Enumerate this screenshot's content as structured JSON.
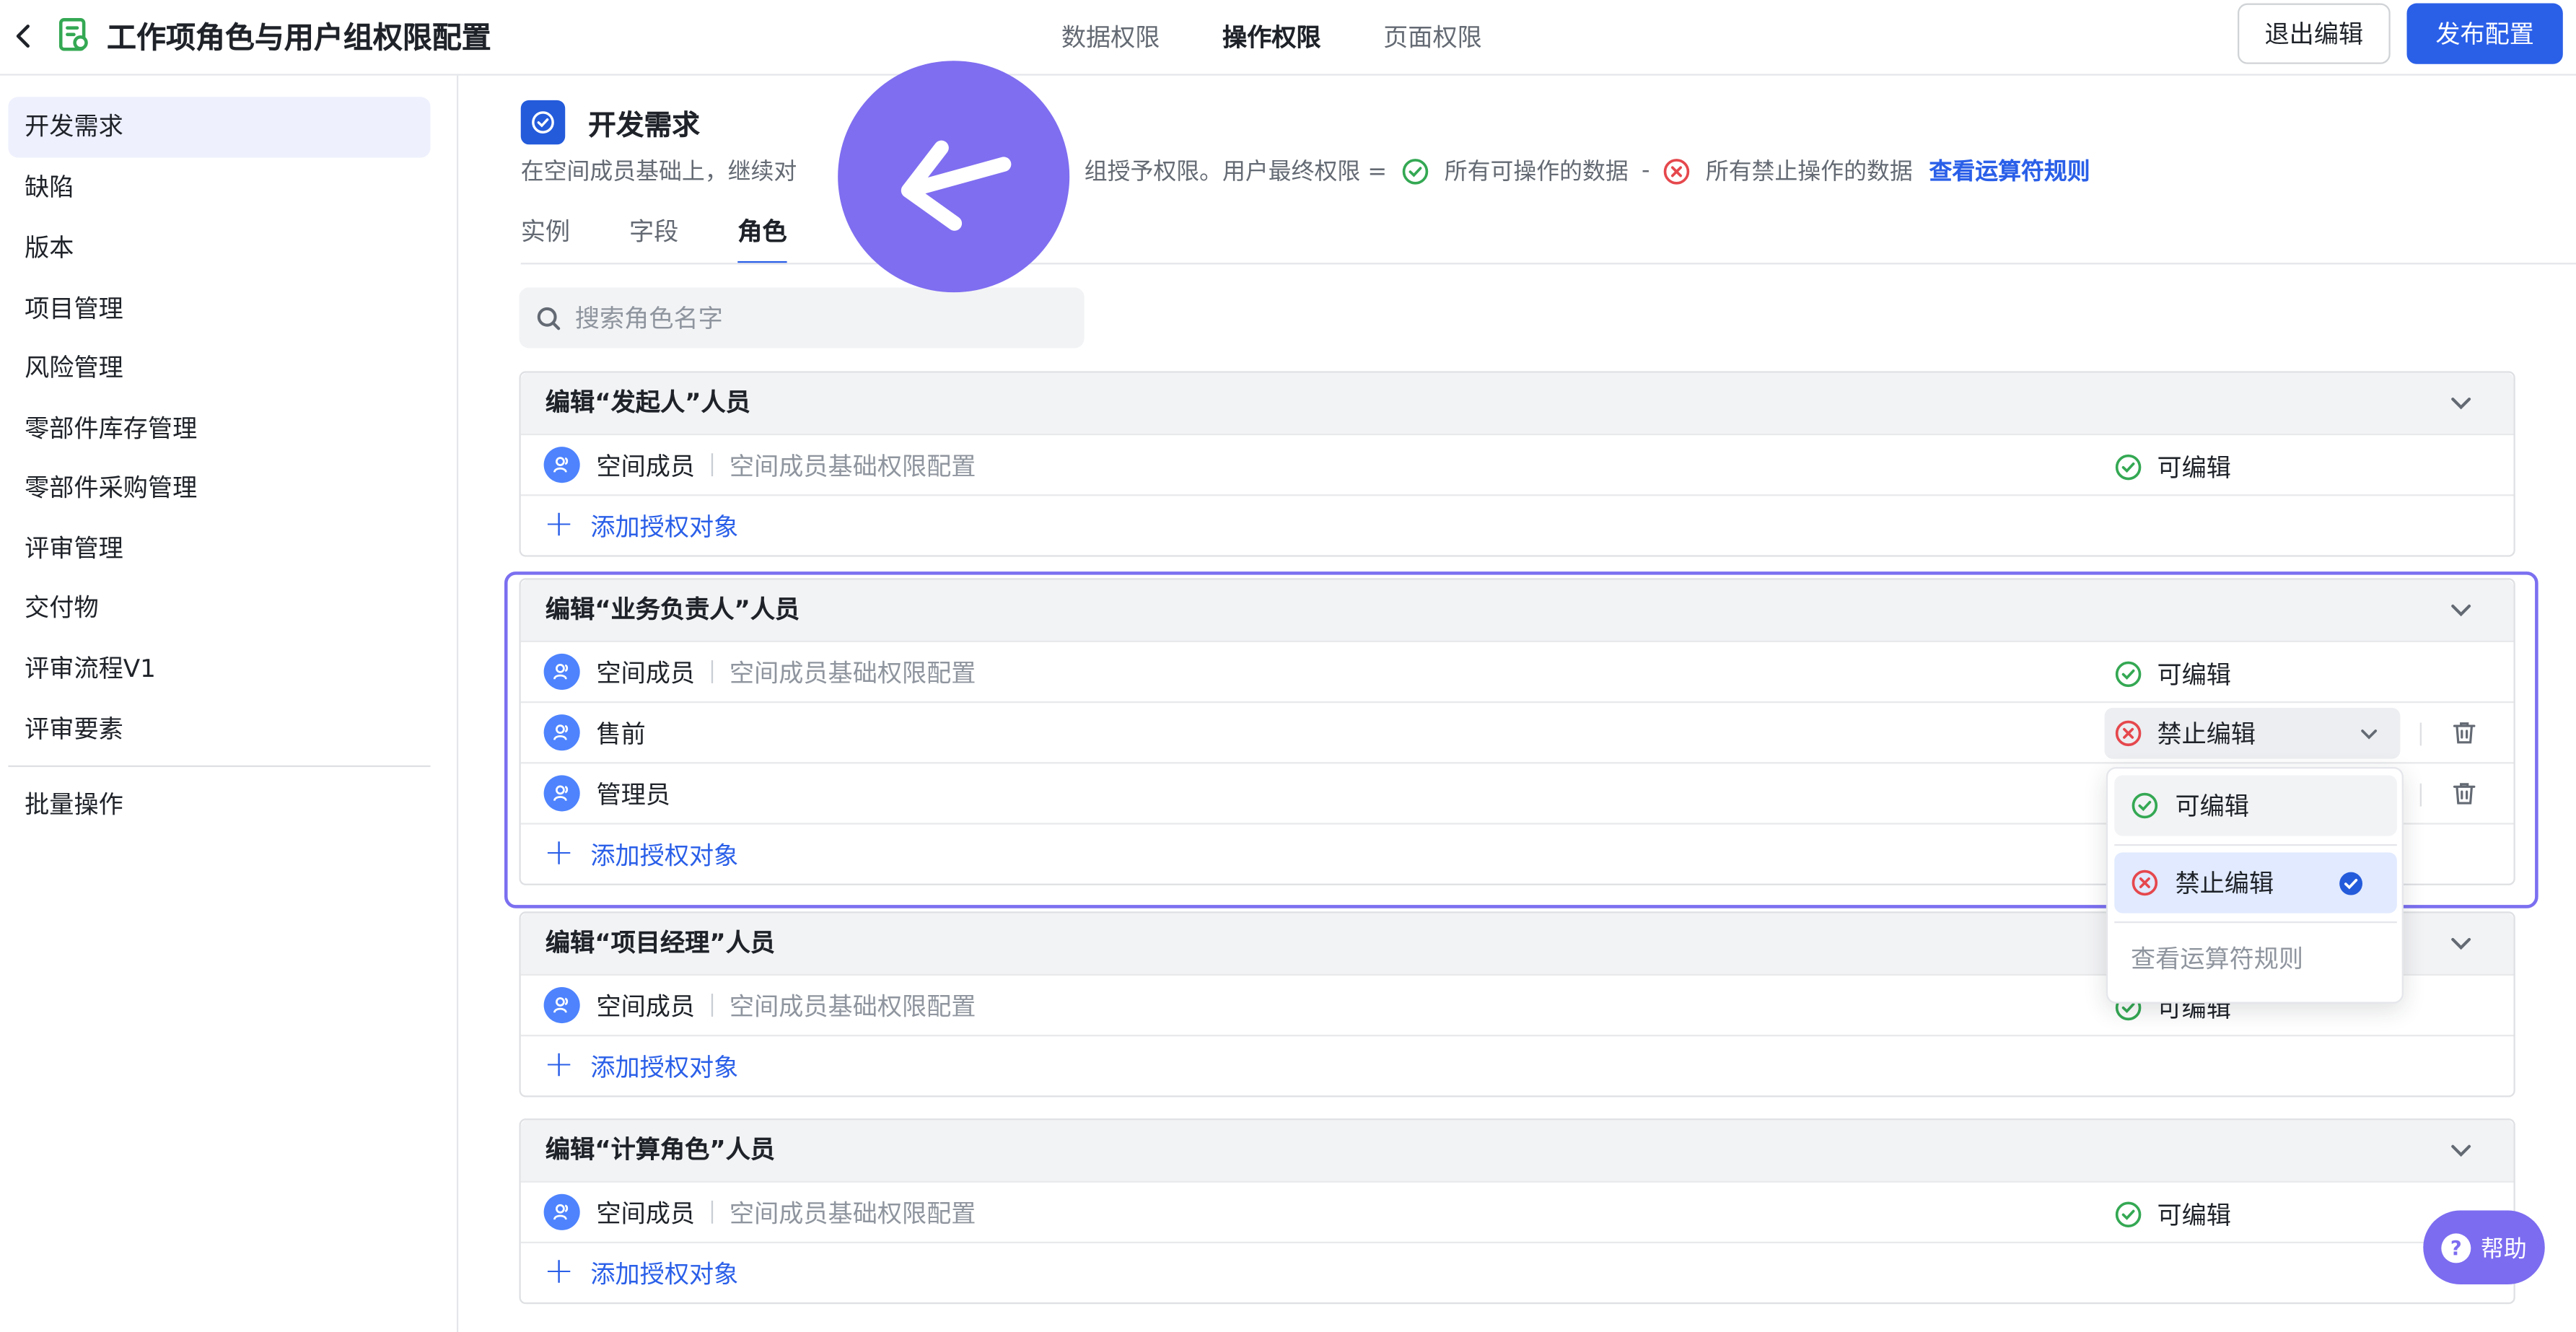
{
  "header": {
    "back_icon": "chevron-left-icon",
    "title": "工作项角色与用户组权限配置",
    "tabs": [
      "数据权限",
      "操作权限",
      "页面权限"
    ],
    "active_tab": "操作权限",
    "exit_label": "退出编辑",
    "publish_label": "发布配置"
  },
  "sidebar": {
    "items": [
      {
        "label": "开发需求",
        "active": true
      },
      {
        "label": "缺陷"
      },
      {
        "label": "版本"
      },
      {
        "label": "项目管理"
      },
      {
        "label": "风险管理"
      },
      {
        "label": "零部件库存管理"
      },
      {
        "label": "零部件采购管理"
      },
      {
        "label": "评审管理"
      },
      {
        "label": "交付物"
      },
      {
        "label": "评审流程V1"
      },
      {
        "label": "评审要素"
      }
    ],
    "batch_label": "批量操作"
  },
  "main": {
    "section_title": "开发需求",
    "desc_part1": "在空间成员基础上，继续对",
    "desc_part2": "组授予权限。用户最终权限 =",
    "desc_allow": "所有可操作的数据",
    "desc_minus": "-",
    "desc_deny": "所有禁止操作的数据",
    "rule_link": "查看运算符规则",
    "sub_tabs": [
      "实例",
      "字段",
      "角色"
    ],
    "active_sub_tab": "角色",
    "search_placeholder": "搜索角色名字",
    "add_label": "添加授权对象",
    "member_label": "空间成员",
    "member_desc": "空间成员基础权限配置",
    "cards": [
      {
        "title": "编辑“发起人”人员",
        "perm": "可编辑"
      },
      {
        "title": "编辑“业务负责人”人员",
        "perm": "可编辑",
        "row2": "售前",
        "row2_perm": "禁止编辑",
        "row3": "管理员"
      },
      {
        "title": "编辑“项目经理”人员",
        "perm": "可编辑"
      },
      {
        "title": "编辑“计算角色”人员",
        "perm": "可编辑"
      }
    ]
  },
  "dropdown": {
    "options": [
      "可编辑",
      "禁止编辑"
    ],
    "selected": "禁止编辑",
    "footer": "查看运算符规则"
  },
  "help_label": "帮助",
  "colors": {
    "accent": "#2a5fe8",
    "allow": "#34a853",
    "deny": "#e5484d",
    "purple": "#7f6ef0"
  }
}
